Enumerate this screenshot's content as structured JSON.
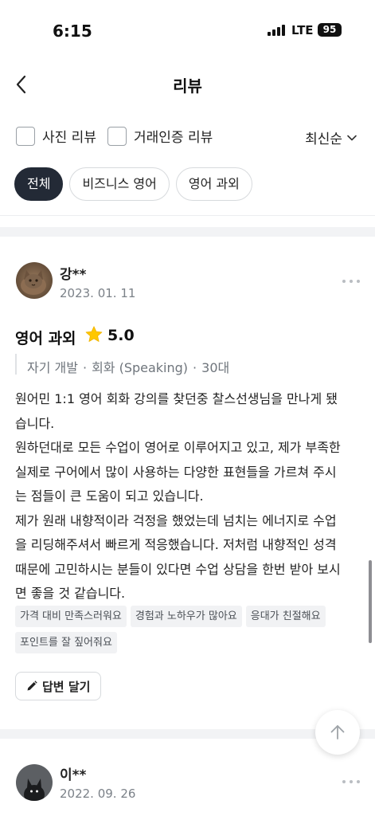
{
  "status_bar": {
    "time": "6:15",
    "network": "LTE",
    "battery": "95"
  },
  "header": {
    "title": "리뷰"
  },
  "filters": {
    "photo_review": "사진 리뷰",
    "verified_review": "거래인증 리뷰",
    "sort": "최신순"
  },
  "categories": [
    {
      "label": "전체",
      "active": true
    },
    {
      "label": "비즈니스 영어",
      "active": false
    },
    {
      "label": "영어 과외",
      "active": false
    }
  ],
  "reviews": [
    {
      "name": "강**",
      "date": "2023. 01. 11",
      "class_title": "영어 과외",
      "rating": "5.0",
      "meta": [
        "자기 개발",
        "회화 (Speaking)",
        "30대"
      ],
      "text_lines": [
        "원어민 1:1 영어 회화 강의를 찾던중 찰스선생님을 만나게 됐",
        "습니다.",
        "원하던대로 모든 수업이 영어로 이루어지고 있고, 제가 부족한",
        "실제로 구어에서 많이 사용하는 다양한 표현들을 가르쳐 주시",
        "는 점들이 큰 도움이 되고 있습니다.",
        "제가 원래 내향적이라 걱정을 했었는데 넘치는 에너지로 수업",
        "을 리딩해주셔서 빠르게 적응했습니다. 저처럼 내향적인 성격",
        "때문에 고민하시는 분들이 있다면 수업 상담을 한번 받아 보시",
        "면 좋을 것 같습니다."
      ],
      "tags": [
        "가격 대비 만족스러워요",
        "경험과 노하우가 많아요",
        "응대가 친절해요",
        "포인트를 잘 짚어줘요"
      ],
      "reply_label": "답변 달기"
    },
    {
      "name": "이**",
      "date": "2022. 09. 26"
    }
  ],
  "colors": {
    "active_chip": "#232a36",
    "star": "#FFC700",
    "tag_bg": "#f1f2f4"
  },
  "icons": [
    "back-arrow-icon",
    "chevron-down-icon",
    "star-icon",
    "more-dots-icon",
    "pencil-icon",
    "arrow-up-icon"
  ]
}
